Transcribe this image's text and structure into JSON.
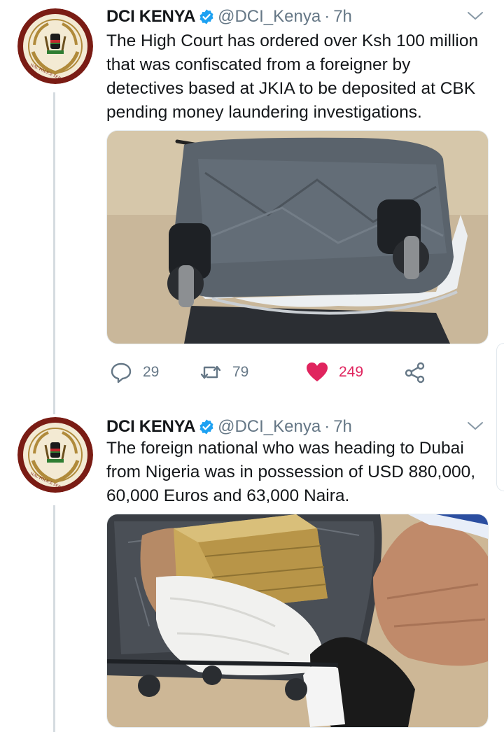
{
  "tweets": [
    {
      "author_name": "DCI KENYA",
      "handle": "@DCI_Kenya",
      "separator": "·",
      "time": "7h",
      "text_lines": [
        "The High Court has ordered over Ksh 100 million",
        "that was confiscated from a foreigner by",
        "detectives based at JKIA to be deposited at CBK",
        "pending money laundering  investigations."
      ],
      "media_icon": "photo-suitcase-closed",
      "avatar_icon": "police-badge-icon",
      "avatar_ring_text": "NAL POLICE SER",
      "replies": "29",
      "retweets": "79",
      "likes": "249",
      "liked": true
    },
    {
      "author_name": "DCI KENYA",
      "handle": "@DCI_Kenya",
      "separator": "·",
      "time": "7h",
      "text_lines": [
        "The foreign national who was heading to Dubai",
        "from Nigeria was in possession of USD 880,000,",
        "60,000 Euros and 63,000 Naira."
      ],
      "media_icon": "photo-suitcase-open-cash",
      "avatar_icon": "police-badge-icon",
      "avatar_ring_text": "NAL POLICE SER"
    }
  ],
  "colors": {
    "text": "#14171a",
    "muted": "#657786",
    "verified": "#1da1f2",
    "like": "#e0245e",
    "thread_line": "#d5dbe0"
  }
}
